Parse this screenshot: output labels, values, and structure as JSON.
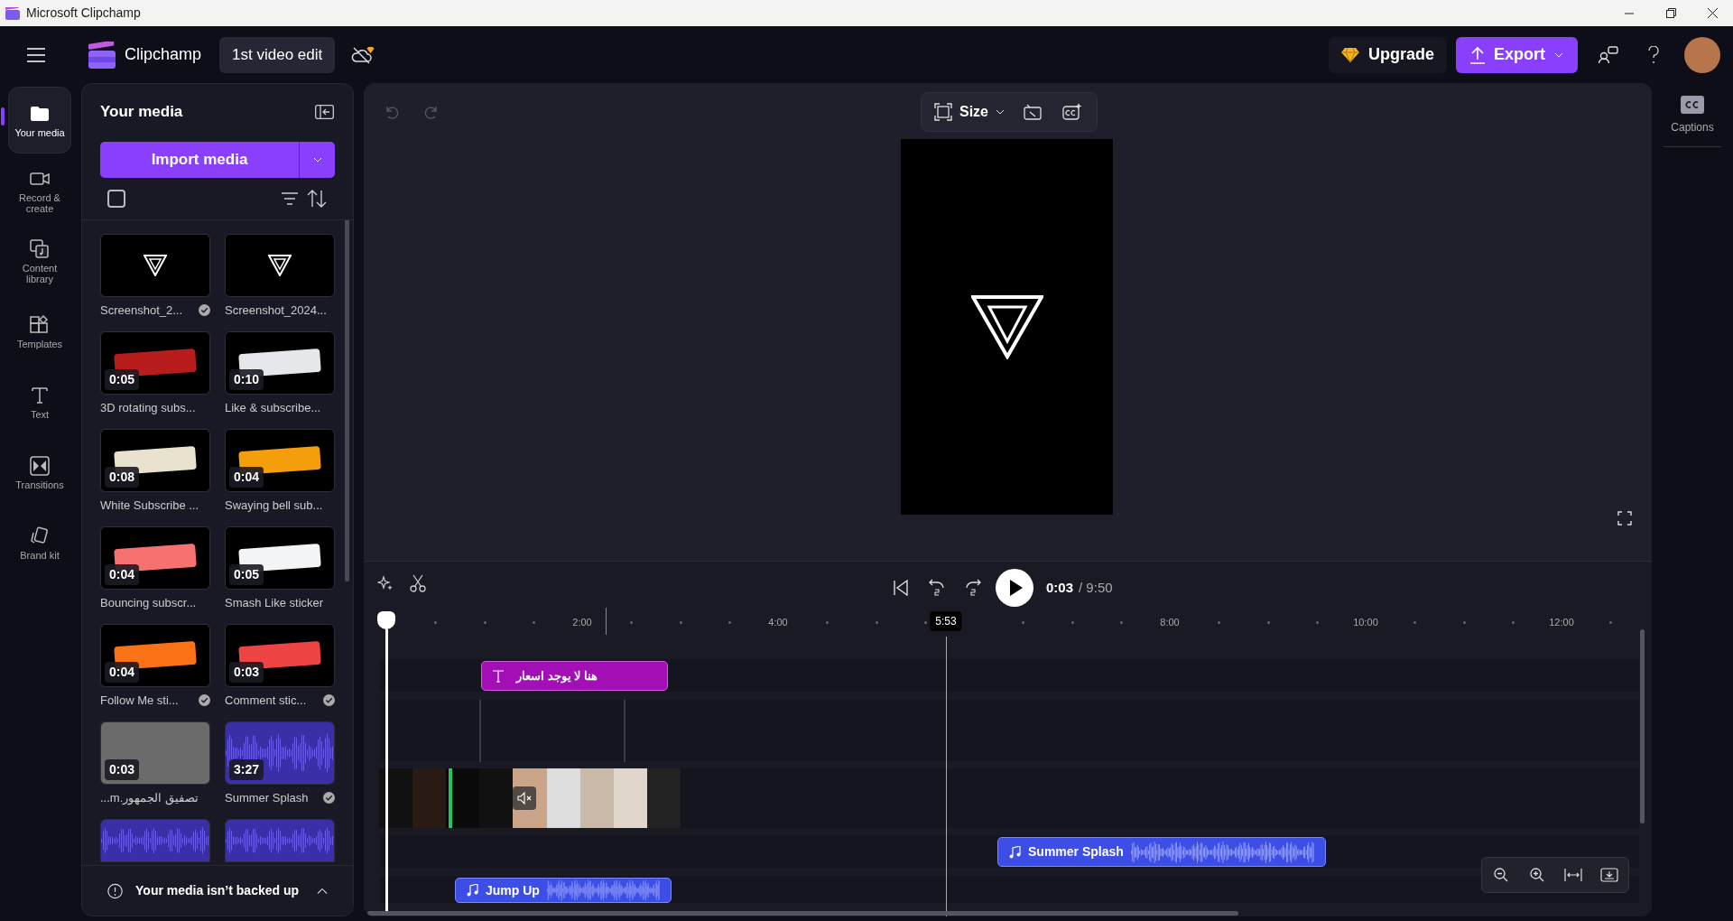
{
  "window": {
    "title": "Microsoft Clipchamp"
  },
  "app_bar": {
    "brand": "Clipchamp",
    "project_name": "1st video edit",
    "upgrade": "Upgrade",
    "export": "Export"
  },
  "nav_rail": [
    {
      "label": "Your media",
      "kind": "folder",
      "selected": true
    },
    {
      "label": "Record & create",
      "kind": "camera",
      "selected": false
    },
    {
      "label": "Content library",
      "kind": "library",
      "selected": false
    },
    {
      "label": "Templates",
      "kind": "templates",
      "selected": false
    },
    {
      "label": "Text",
      "kind": "text",
      "selected": false
    },
    {
      "label": "Transitions",
      "kind": "transitions",
      "selected": false
    },
    {
      "label": "Brand kit",
      "kind": "brand",
      "selected": false
    }
  ],
  "media_panel": {
    "title": "Your media",
    "import_button": "Import media",
    "select_all": {
      "checked": false
    },
    "items": [
      {
        "name": "Screenshot_2...",
        "kind": "logo",
        "added": true
      },
      {
        "name": "Screenshot_2024...",
        "kind": "logo",
        "added": false
      },
      {
        "name": "3D rotating subs...",
        "duration": "0:05",
        "kind": "sticker",
        "color": "#b91c1c",
        "added": false
      },
      {
        "name": "Like & subscribe...",
        "duration": "0:10",
        "kind": "sticker",
        "color": "#e5e7eb",
        "added": false
      },
      {
        "name": "White Subscribe ...",
        "duration": "0:08",
        "kind": "sticker",
        "color": "#e8e2cf",
        "added": false
      },
      {
        "name": "Swaying bell sub...",
        "duration": "0:04",
        "kind": "sticker",
        "color": "#f59e0b",
        "added": false
      },
      {
        "name": "Bouncing subscr...",
        "duration": "0:04",
        "kind": "sticker",
        "color": "#f87171",
        "added": false
      },
      {
        "name": "Smash Like sticker",
        "duration": "0:05",
        "kind": "sticker",
        "color": "#f3f4f6",
        "added": false
      },
      {
        "name": "Follow Me sti...",
        "duration": "0:04",
        "kind": "sticker",
        "color": "#f97316",
        "added": true
      },
      {
        "name": "Comment stic...",
        "duration": "0:03",
        "kind": "sticker",
        "color": "#ef4444",
        "added": true
      },
      {
        "name": "تصفيق الجمهور.m...",
        "duration": "0:03",
        "kind": "photo",
        "added": false
      },
      {
        "name": "Summer Splash",
        "duration": "3:27",
        "kind": "audio",
        "added": true
      },
      {
        "kind": "audio"
      },
      {
        "kind": "audio"
      }
    ],
    "backup_notice": "Your media isn’t backed up"
  },
  "preview": {
    "size_button": "Size"
  },
  "timeline": {
    "current_time": "0:03",
    "total_time": "/ 9:50",
    "hover_time": "5:53",
    "ruler": [
      "2:00",
      "4:00",
      "8:00",
      "10:00",
      "12:00"
    ],
    "clips": [
      {
        "kind": "text",
        "label": "هنا لا يوجد اسعار",
        "color": "#a10fb5"
      },
      {
        "kind": "video",
        "muted": true
      },
      {
        "kind": "audio",
        "label": "Summer Splash",
        "color": "#3d4ee6"
      },
      {
        "kind": "audio",
        "label": "Jump Up",
        "color": "#3d4ee6"
      }
    ]
  },
  "captions_panel": {
    "label": "Captions"
  }
}
